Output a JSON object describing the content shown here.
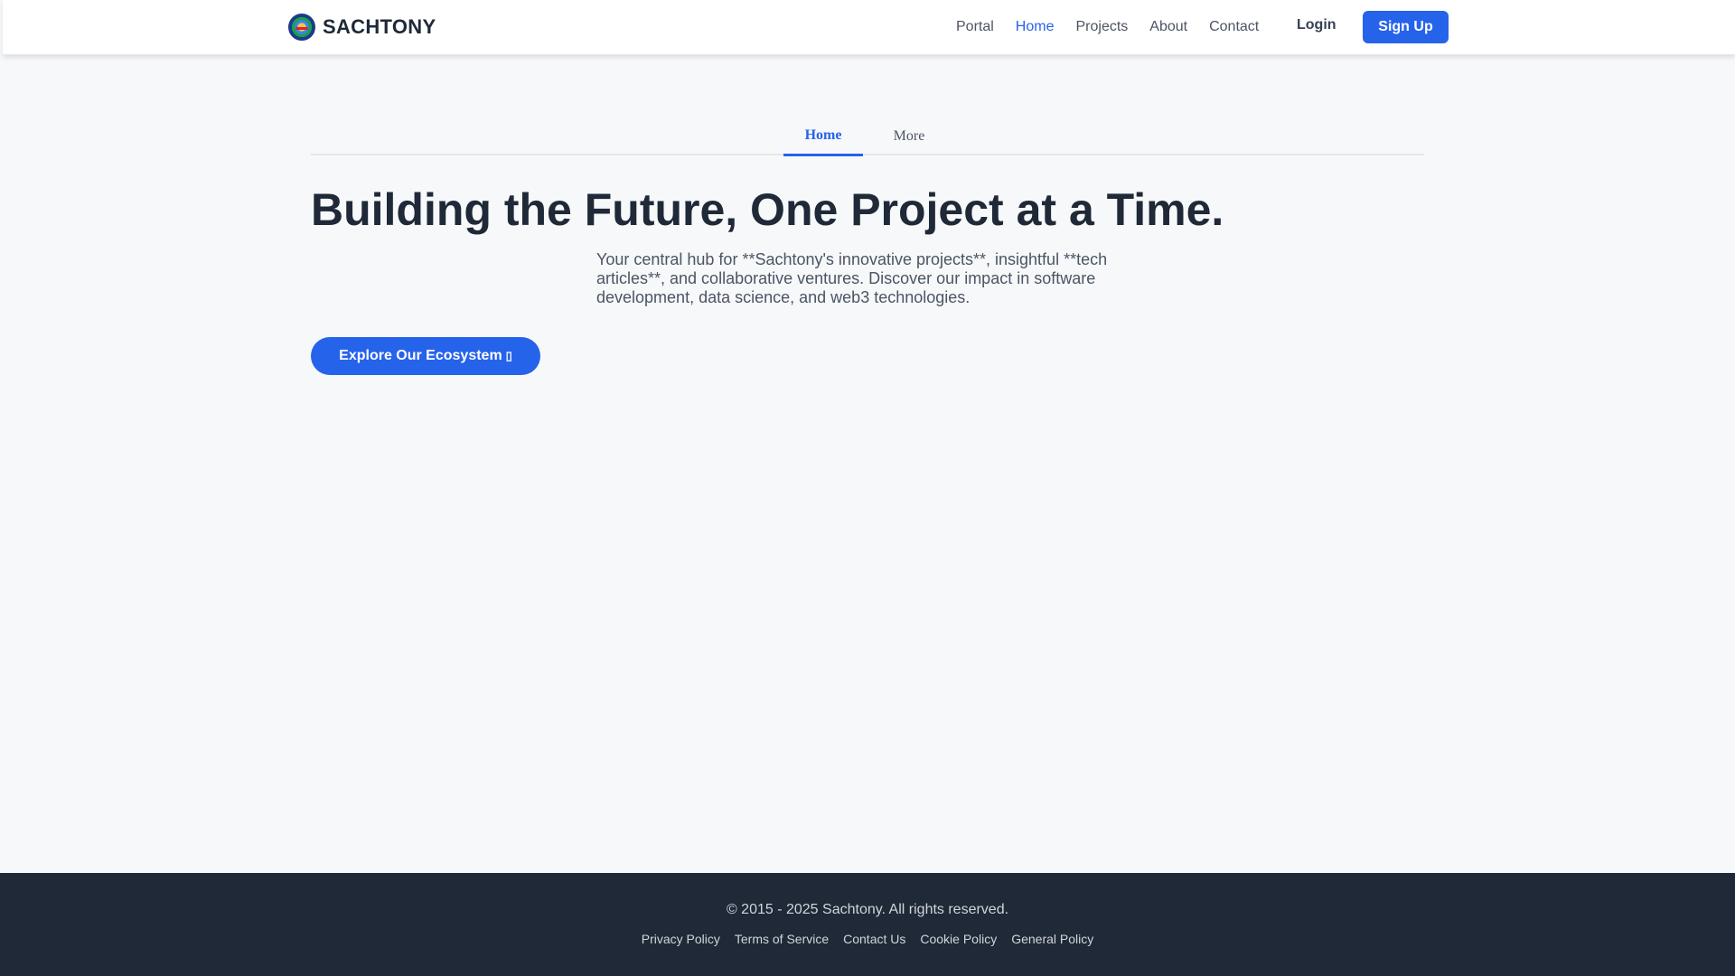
{
  "header": {
    "brand": "SACHTONY",
    "nav": [
      "Portal",
      "Home",
      "Projects",
      "About",
      "Contact"
    ],
    "active_nav": "Home",
    "login": "Login",
    "signup": "Sign Up"
  },
  "tabs": {
    "home": "Home",
    "more": "More"
  },
  "hero": {
    "title": "Building the Future, One Project at a Time.",
    "description": "Your central hub for **Sachtony's innovative projects**, insightful **tech articles**, and collaborative ventures. Discover our impact in software development, data science, and web3 technologies.",
    "cta": "Explore Our Ecosystem",
    "cta_icon": "arrow-right-icon"
  },
  "footer": {
    "copyright": "© 2015 - 2025 Sachtony. All rights reserved.",
    "links": [
      "Privacy Policy",
      "Terms of Service",
      "Contact Us",
      "Cookie Policy",
      "General Policy"
    ]
  },
  "colors": {
    "accent": "#2563eb",
    "footer_bg": "#1f2937",
    "page_bg": "#f7f8fa"
  }
}
